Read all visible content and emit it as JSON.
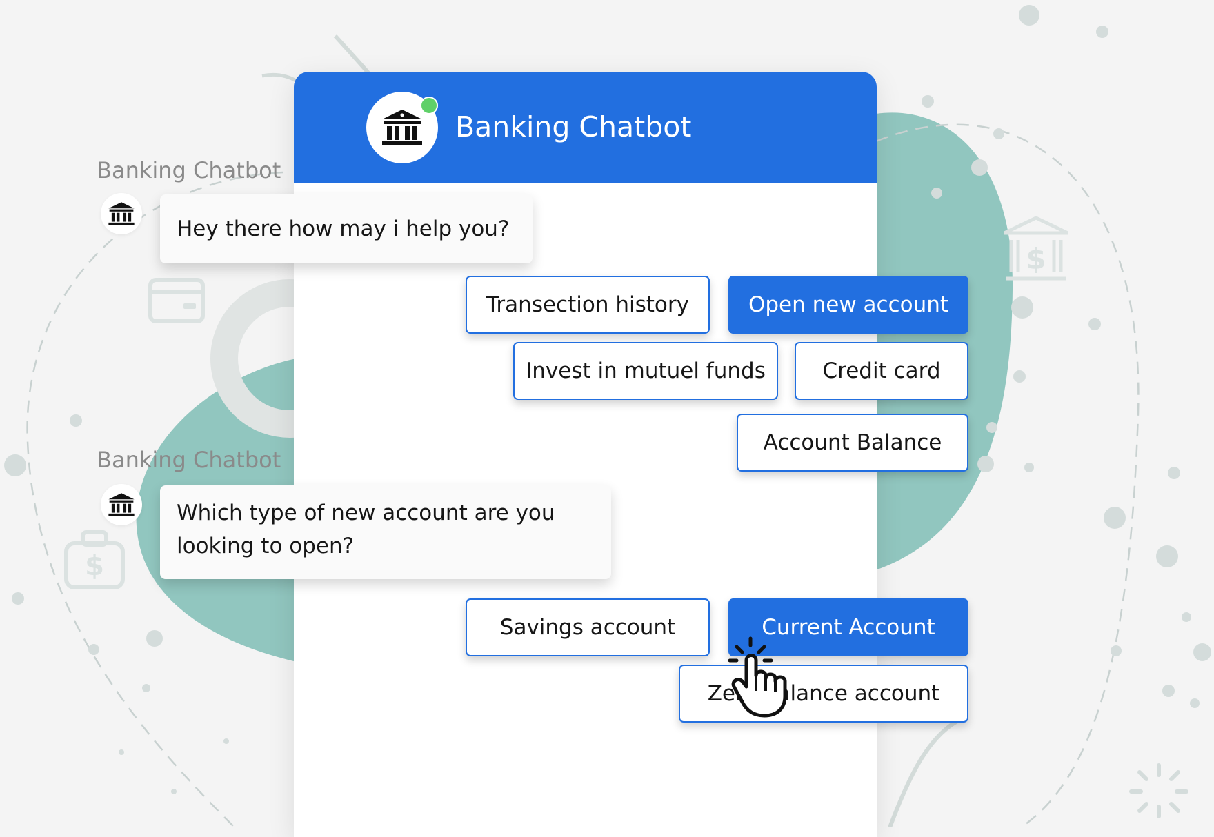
{
  "colors": {
    "brand_blue": "#226fe0",
    "teal_blob": "#91c6bf",
    "online_green": "#5fd068",
    "page_background": "#f4f4f4"
  },
  "header": {
    "title": "Banking Chatbot",
    "avatar_icon": "bank-icon",
    "status_icon": "online-dot"
  },
  "messages": [
    {
      "sender": "Banking Chatbot",
      "text": "Hey there how may i help you?"
    },
    {
      "sender": "Banking Chatbot",
      "text": "Which type of new account are you looking to open?"
    }
  ],
  "quick_replies_1": [
    {
      "label": "Transection history",
      "selected": false
    },
    {
      "label": "Open new account",
      "selected": true
    },
    {
      "label": "Invest in mutuel funds",
      "selected": false
    },
    {
      "label": "Credit card",
      "selected": false
    },
    {
      "label": "Account Balance",
      "selected": false
    }
  ],
  "quick_replies_2": [
    {
      "label": "Savings account",
      "selected": false
    },
    {
      "label": "Current Account",
      "selected": true
    },
    {
      "label": "Zero balance account",
      "selected": false
    }
  ],
  "decor_icons": [
    "credit-card-icon",
    "money-bag-icon",
    "bank-dollar-icon",
    "hand-cursor-icon"
  ]
}
